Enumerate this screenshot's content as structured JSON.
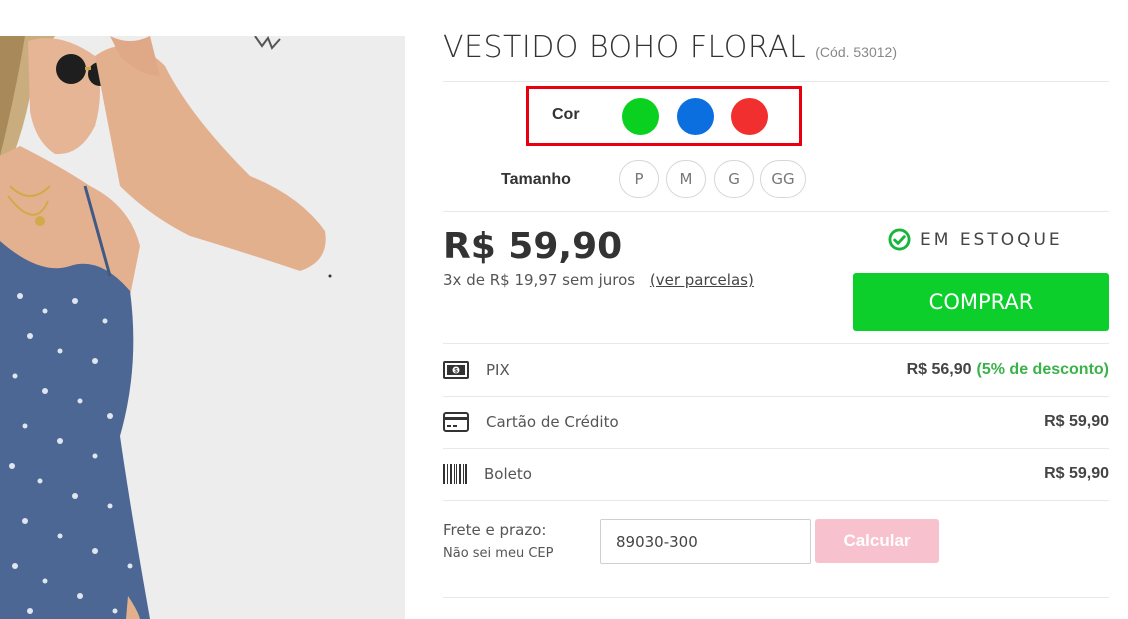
{
  "product": {
    "title": "VESTIDO BOHO FLORAL",
    "code": "(Cód. 53012)",
    "image_alt": "Modelo usando vestido floral azul"
  },
  "color": {
    "label": "Cor",
    "swatches": [
      {
        "name": "green",
        "hex": "#0ad11f"
      },
      {
        "name": "blue",
        "hex": "#0b6fe0"
      },
      {
        "name": "red",
        "hex": "#f22f2f"
      }
    ],
    "highlight_color": "#e8000f"
  },
  "size": {
    "label": "Tamanho",
    "options": [
      "P",
      "M",
      "G",
      "GG"
    ]
  },
  "pricing": {
    "price": "R$ 59,90",
    "installments": "3x de R$ 19,97 sem juros",
    "installments_link": "(ver parcelas)",
    "stock_status": "EM ESTOQUE",
    "buy_label": "COMPRAR"
  },
  "payment_methods": [
    {
      "name": "PIX",
      "icon": "cash-icon",
      "value": "R$ 56,90",
      "discount": "(5% de desconto)"
    },
    {
      "name": "Cartão de Crédito",
      "icon": "credit-card-icon",
      "value": "R$ 59,90",
      "discount": ""
    },
    {
      "name": "Boleto",
      "icon": "barcode-icon",
      "value": "R$ 59,90",
      "discount": ""
    }
  ],
  "shipping": {
    "label": "Frete e prazo:",
    "help": "Não sei meu CEP",
    "cep_value": "89030-300",
    "calc_label": "Calcular"
  },
  "colors": {
    "buy_button": "#0ccf2c",
    "stock_check": "#16b53c",
    "discount_text": "#3ab24a",
    "calc_button": "#f7c1cd"
  }
}
